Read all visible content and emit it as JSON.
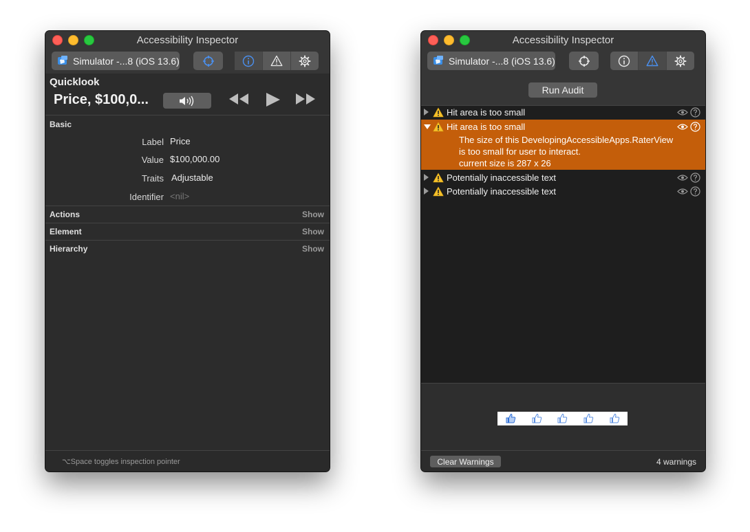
{
  "colors": {
    "accent": "#3b82f6",
    "highlight": "#c45e0a",
    "warning": "#f5c02a",
    "window_bg": "#2c2c2c"
  },
  "left_window": {
    "title": "Accessibility Inspector",
    "toolbar": {
      "target_label": "Simulator -...8 (iOS 13.6)",
      "target_icon": "simulator-icon",
      "icons": [
        "crosshair-icon",
        "info-icon",
        "warning-icon",
        "gear-icon"
      ],
      "active_segment": "inspection"
    },
    "quicklook": {
      "title": "Quicklook",
      "value": "Price, $100,0...",
      "controls": [
        "speaker-icon",
        "rewind-icon",
        "play-icon",
        "fast-forward-icon"
      ]
    },
    "basic": {
      "heading": "Basic",
      "rows": [
        {
          "label": "Label",
          "value": "Price"
        },
        {
          "label": "Value",
          "value": "$100,000.00"
        },
        {
          "label": "Traits",
          "value": "Adjustable"
        },
        {
          "label": "Identifier",
          "value": "<nil>"
        }
      ]
    },
    "sections": [
      {
        "title": "Actions",
        "action": "Show"
      },
      {
        "title": "Element",
        "action": "Show"
      },
      {
        "title": "Hierarchy",
        "action": "Show"
      }
    ],
    "footer_note": "⌥Space toggles inspection pointer"
  },
  "right_window": {
    "title": "Accessibility Inspector",
    "toolbar": {
      "target_label": "Simulator -...8 (iOS 13.6)",
      "target_icon": "simulator-icon",
      "active_segment": "audit"
    },
    "run_audit_label": "Run Audit",
    "audit_items": [
      {
        "text": "Hit area is too small",
        "expanded": false
      },
      {
        "text": "Hit area is too small",
        "expanded": true,
        "detail": [
          "The size of this DevelopingAccessibleApps.RaterView",
          "is too small for user to interact.",
          "current size is 287 x 26"
        ]
      },
      {
        "text": "Potentially inaccessible text",
        "expanded": false
      },
      {
        "text": "Potentially inaccessible text",
        "expanded": false
      }
    ],
    "preview": {
      "thumbs": [
        "thumbs-up-icon",
        "thumbs-up-icon",
        "thumbs-up-icon",
        "thumbs-up-icon",
        "thumbs-up-icon"
      ],
      "first_selected": true
    },
    "clear_label": "Clear Warnings",
    "warning_count": "4 warnings"
  }
}
